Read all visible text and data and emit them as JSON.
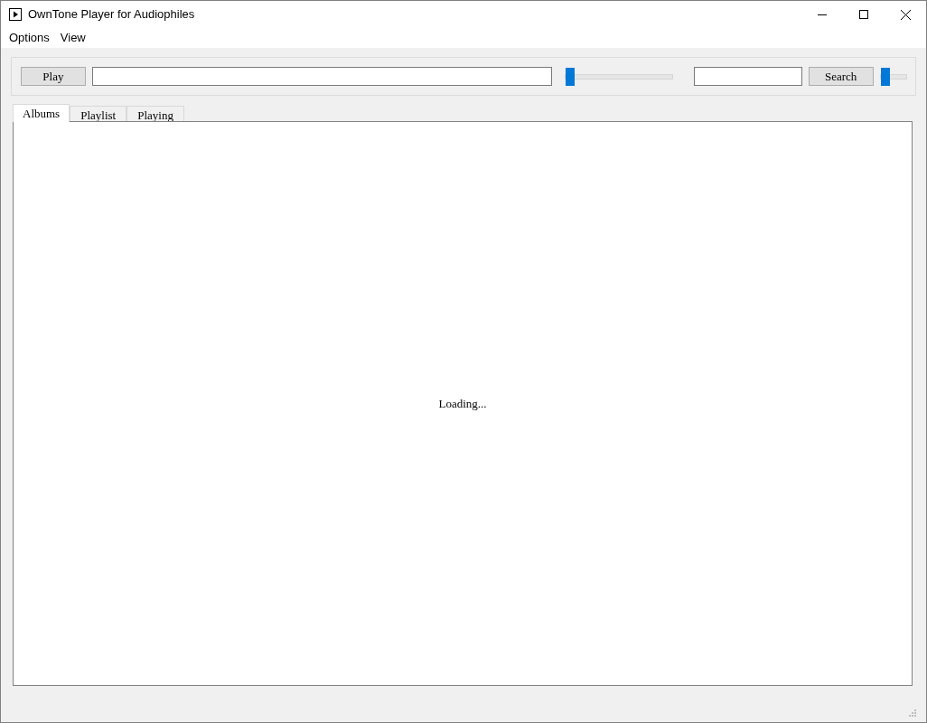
{
  "window": {
    "title": "OwnTone Player for Audiophiles"
  },
  "menu": [
    "Options",
    "View"
  ],
  "toolbar": {
    "play_button": "Play",
    "position_slider": {
      "level": 0
    },
    "search_button": "Search",
    "volume_slider": {
      "level": 0
    }
  },
  "tabs": [
    {
      "label": "Albums",
      "selected": true
    },
    {
      "label": "Playlist",
      "selected": false
    },
    {
      "label": "Playing",
      "selected": false
    }
  ],
  "content": {
    "status": "Loading..."
  }
}
